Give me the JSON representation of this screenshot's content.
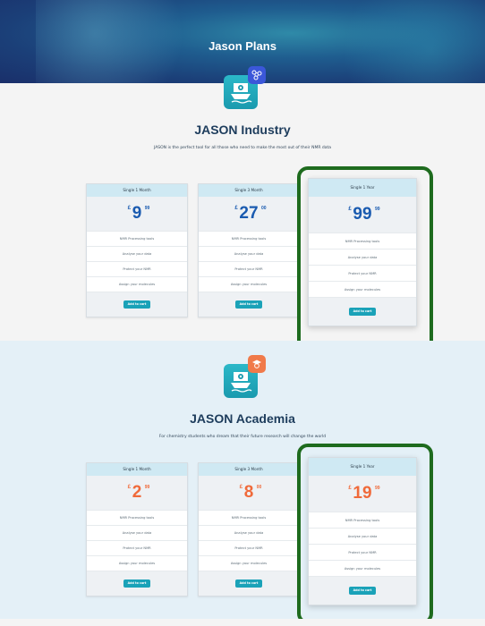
{
  "hero": {
    "title": "Jason Plans"
  },
  "industry": {
    "title": "JASON Industry",
    "tagline": "JASON is the perfect tool for all those who need to make the most out of their NMR data",
    "badge_icon": "molecule-icon",
    "price_color": "#1a5bb0",
    "plans": [
      {
        "name": "Single 1 Month",
        "currency": "£",
        "price": "9",
        "cents": "99"
      },
      {
        "name": "Single 3 Month",
        "currency": "£",
        "price": "27",
        "cents": "00"
      },
      {
        "name": "Single 1 Year",
        "currency": "£",
        "price": "99",
        "cents": "99"
      }
    ]
  },
  "academia": {
    "title": "JASON Academia",
    "tagline": "For chemistry students who dream that their future research will change the world",
    "badge_icon": "student-icon",
    "price_color": "#f06a3a",
    "plans": [
      {
        "name": "Single 1 Month",
        "currency": "£",
        "price": "2",
        "cents": "99"
      },
      {
        "name": "Single 3 Month",
        "currency": "£",
        "price": "8",
        "cents": "00"
      },
      {
        "name": "Single 1 Year",
        "currency": "£",
        "price": "19",
        "cents": "99"
      }
    ]
  },
  "features": [
    "NMR Processing tools",
    "Analyse your data",
    "Protect your NMR",
    "Assign your molecules"
  ],
  "add_to_cart_label": "Add to cart",
  "colors": {
    "accent": "#1aa2b8",
    "highlight": "#1e6b1e",
    "title": "#1d3c5c"
  }
}
